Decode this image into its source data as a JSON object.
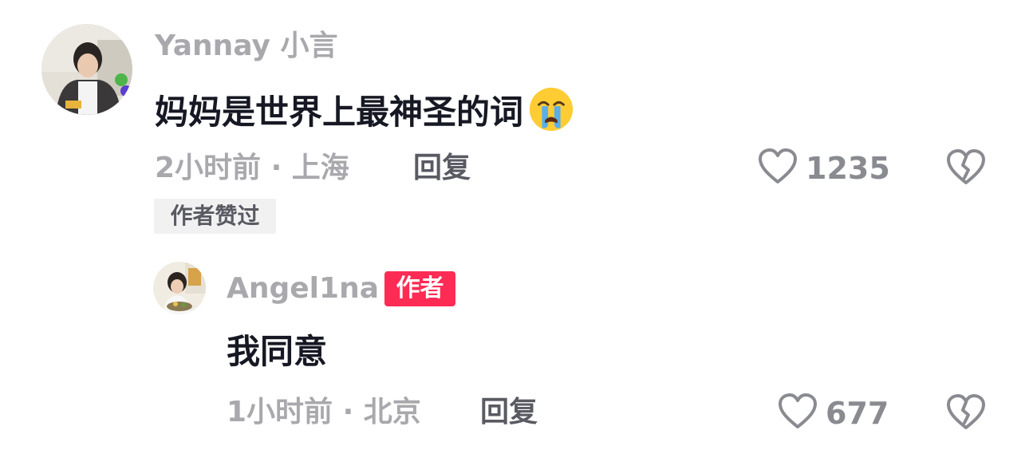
{
  "comment": {
    "username": "Yannay 小言",
    "text": "妈妈是世界上最神圣的词",
    "emoji": "loudly-crying-face-emoji",
    "time_location": "2小时前 · 上海",
    "reply_label": "回复",
    "like_count": "1235",
    "liked_badge": "作者赞过"
  },
  "reply": {
    "username": "Angel1na",
    "author_badge": "作者",
    "text": "我同意",
    "time_location": "1小时前 · 北京",
    "reply_label": "回复",
    "like_count": "677"
  },
  "colors": {
    "text_primary": "#161823",
    "text_secondary": "#a9a9ad",
    "author_badge_bg": "#fe2c55"
  }
}
